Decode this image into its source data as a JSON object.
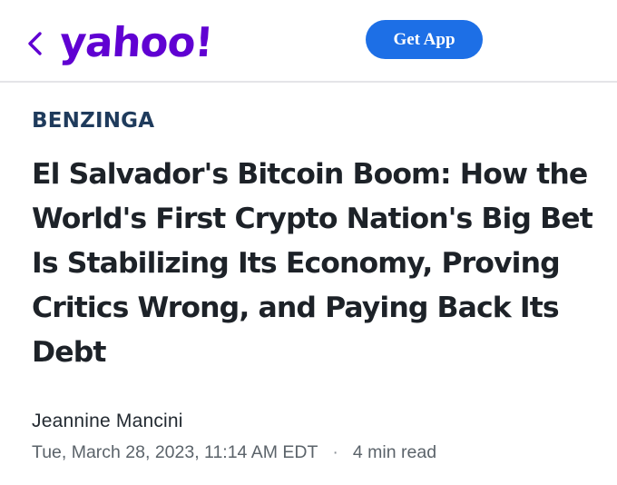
{
  "header": {
    "logo_text": "yahoo!",
    "get_app_label": "Get App",
    "back_icon": "chevron-left-icon",
    "colors": {
      "logo": "#6001d2",
      "get_app_bg": "#1d6fe6",
      "divider": "#e4e4e8"
    }
  },
  "article": {
    "publisher": "BENZINGA",
    "headline": "El Salvador's Bitcoin Boom: How the World's First Crypto Nation's Big Bet Is Stabilizing Its Economy, Proving Critics Wrong, and Paying Back Its Debt",
    "author": "Jeannine Mancini",
    "date": "Tue, March 28, 2023, 11:14 AM EDT",
    "separator": "·",
    "read_time": "4 min read"
  }
}
